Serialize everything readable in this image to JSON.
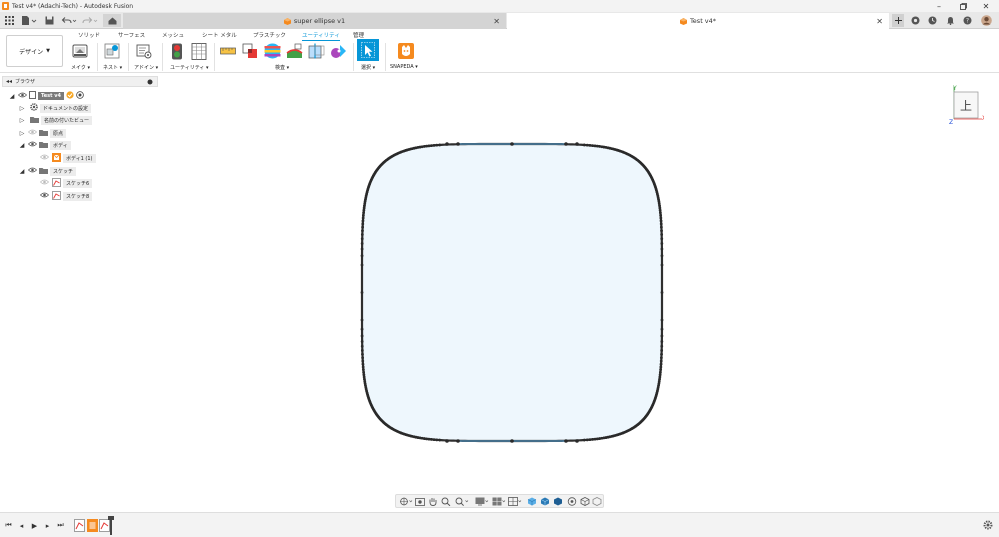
{
  "window": {
    "title": "Test v4* (Adachi-Tech) - Autodesk Fusion",
    "controls": [
      "minimize-icon",
      "restore-icon",
      "close-icon"
    ]
  },
  "tabs": {
    "items": [
      {
        "label": "super ellipse v1",
        "active": false
      },
      {
        "label": "Test v4*",
        "active": true
      }
    ]
  },
  "toolbar": {
    "workspace": "デザイン",
    "ribbon_tabs": [
      {
        "label": "ソリッド",
        "active": false
      },
      {
        "label": "サーフェス",
        "active": false
      },
      {
        "label": "メッシュ",
        "active": false
      },
      {
        "label": "シート メタル",
        "active": false
      },
      {
        "label": "プラスチック",
        "active": false
      },
      {
        "label": "ユーティリティ",
        "active": true
      },
      {
        "label": "管理",
        "active": false
      }
    ],
    "groups": {
      "make": "メイク",
      "nest": "ネスト",
      "addins": "アドイン",
      "utility": "ユーティリティ",
      "inspect": "検査",
      "select": "選択",
      "snapeda": "SNAPEDA"
    }
  },
  "browser": {
    "title": "ブラウザ",
    "root": "Test v4",
    "items": {
      "doc_settings": "ドキュメントの設定",
      "named_views": "名前の付いたビュー",
      "origin": "原点",
      "bodies": "ボディ",
      "body1": "ボディ1 (1)",
      "sketches": "スケッチ",
      "sketch6": "スケッチ6",
      "sketch8": "スケッチ8"
    }
  },
  "viewcube": {
    "face": "上",
    "axes": {
      "x": "X",
      "y": "Y",
      "z": "Z"
    }
  },
  "colors": {
    "accent": "#0696d7",
    "sketch_fill": "#eef7fd",
    "sketch_stroke": "#2f2f2f",
    "axis_x": "#e53935",
    "axis_y": "#43a047",
    "axis_z": "#1e4bd8",
    "fusion_orange": "#f58a1f"
  }
}
